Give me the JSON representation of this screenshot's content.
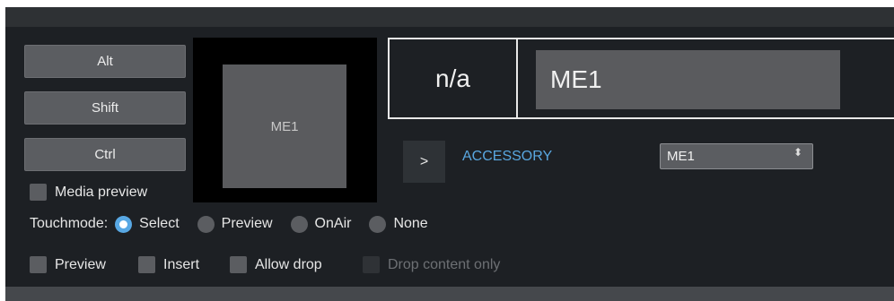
{
  "modifiers": {
    "alt": "Alt",
    "shift": "Shift",
    "ctrl": "Ctrl"
  },
  "preview": {
    "thumb_label": "ME1"
  },
  "status": {
    "na_text": "n/a",
    "name_text": "ME1"
  },
  "expand_button": ">",
  "accessory": {
    "label": "ACCESSORY",
    "selected": "ME1",
    "arrows": "⬍"
  },
  "media_preview": {
    "label": "Media preview",
    "checked": false
  },
  "touchmode": {
    "label": "Touchmode:",
    "options": [
      {
        "label": "Select",
        "selected": true
      },
      {
        "label": "Preview",
        "selected": false
      },
      {
        "label": "OnAir",
        "selected": false
      },
      {
        "label": "None",
        "selected": false
      }
    ]
  },
  "options": {
    "preview": "Preview",
    "insert": "Insert",
    "allow_drop": "Allow drop",
    "drop_content_only": "Drop content only"
  },
  "colors": {
    "accent": "#58a8e4",
    "accessory_label": "#59a7e0",
    "panel_bg": "#1d2024"
  }
}
